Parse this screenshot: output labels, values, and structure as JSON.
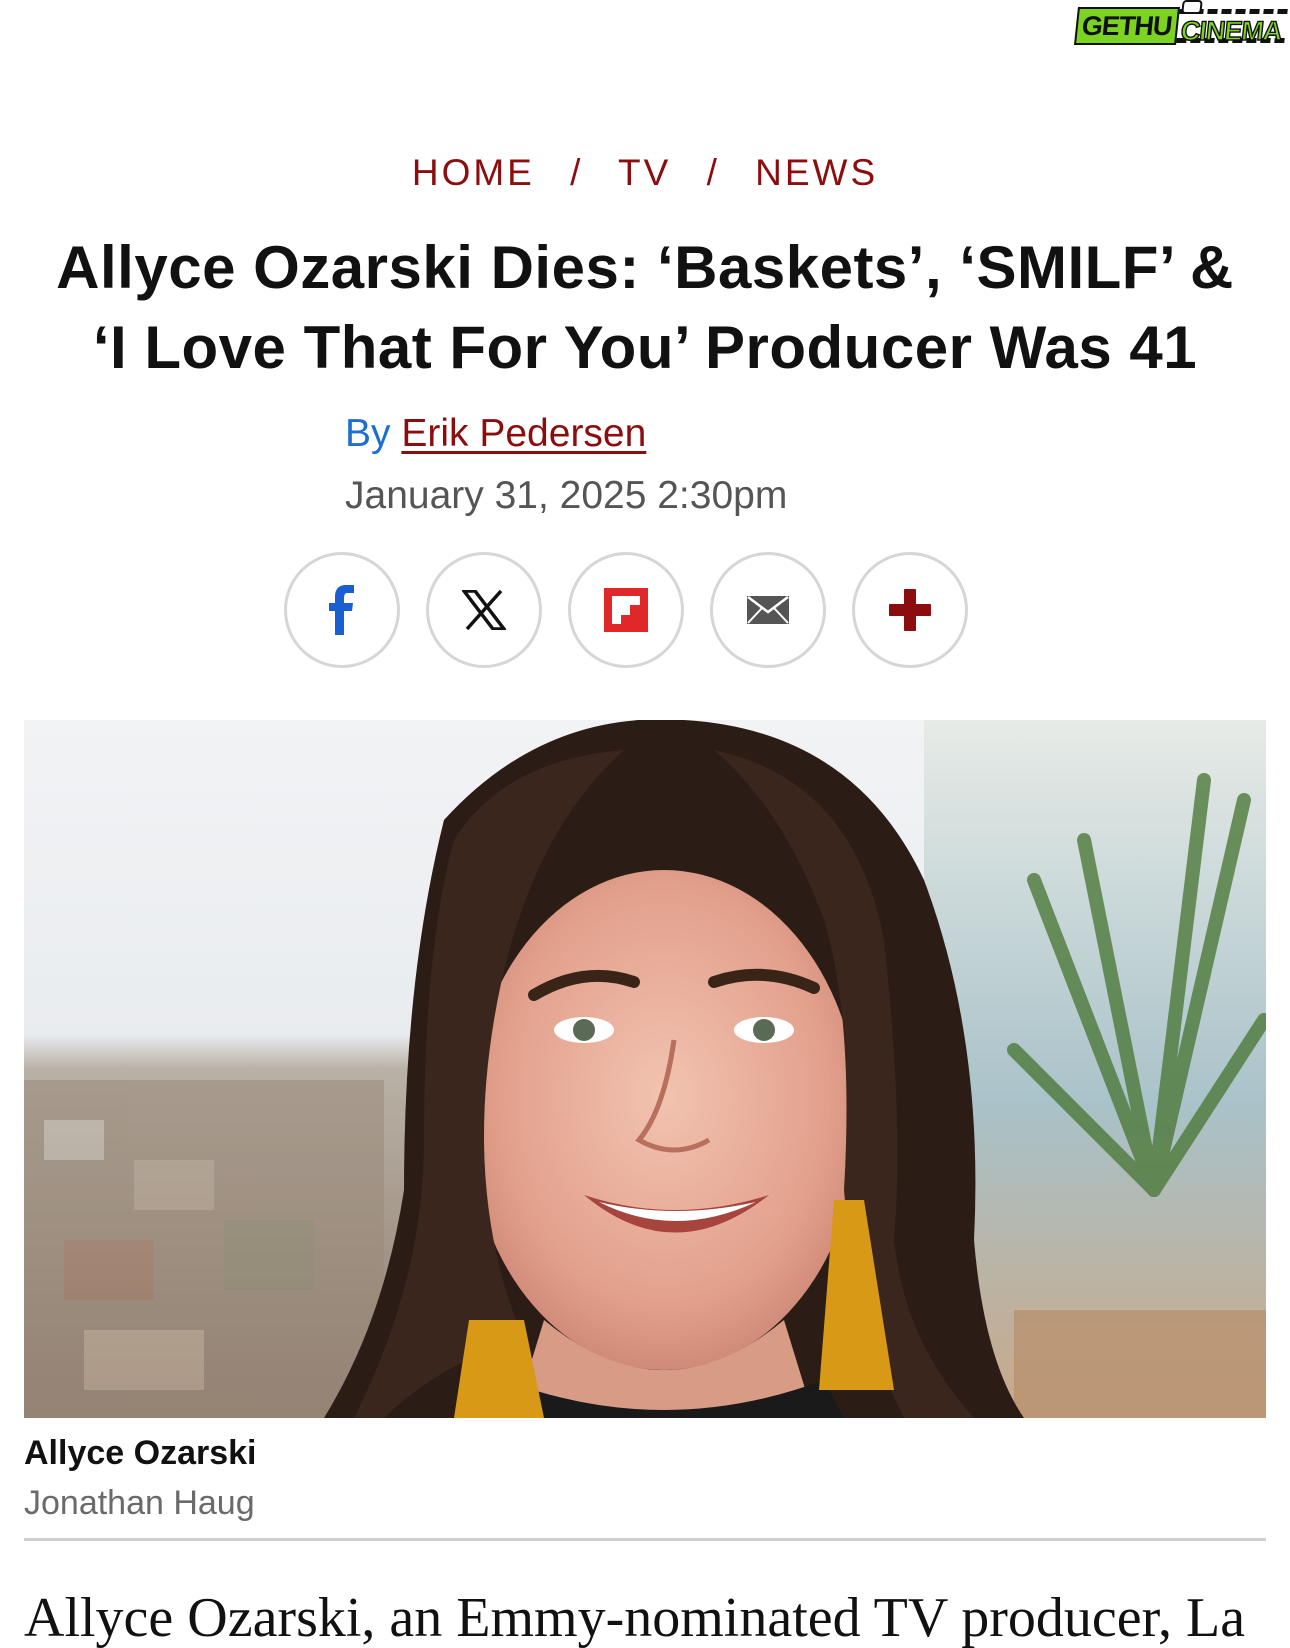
{
  "watermark": {
    "part1": "GETHU",
    "part2": "CINEMA"
  },
  "breadcrumb": {
    "items": [
      "HOME",
      "TV",
      "NEWS"
    ],
    "separator": "/"
  },
  "article": {
    "title_line1": "Allyce Ozarski Dies: ‘Baskets’, ‘SMILF’ &",
    "title_line2": "‘I Love That For You’ Producer Was 41",
    "by_prefix": "By",
    "author": "Erik Pedersen",
    "date": "January 31, 2025 2:30pm",
    "body_start": "Allyce Ozarski, an Emmy-nominated TV producer, La"
  },
  "share": {
    "buttons": [
      {
        "icon": "facebook-icon",
        "color": "#1a5fd1"
      },
      {
        "icon": "x-icon",
        "color": "#111111"
      },
      {
        "icon": "flipboard-icon",
        "color": "#e12828"
      },
      {
        "icon": "email-icon",
        "color": "#555555"
      },
      {
        "icon": "plus-icon",
        "color": "#8b0d0d"
      }
    ]
  },
  "hero": {
    "caption": "Allyce Ozarski",
    "credit": "Jonathan Haug"
  },
  "colors": {
    "accent": "#8b0d0d",
    "link_blue": "#1a6fd1"
  }
}
